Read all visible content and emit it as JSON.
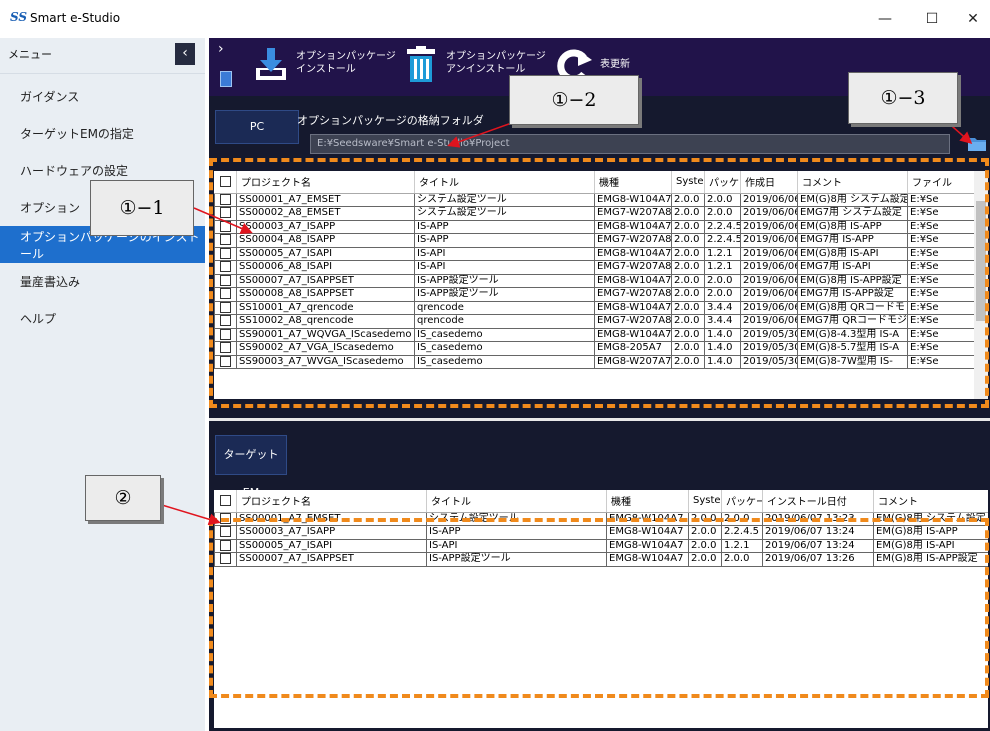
{
  "app": {
    "logo": "SS",
    "title": "Smart e-Studio",
    "min": "—",
    "max": "☐",
    "close": "✕"
  },
  "sidebar": {
    "menu_title": "メニュー",
    "collapse": "‹",
    "items": [
      {
        "label": "ガイダンス",
        "active": false
      },
      {
        "label": "ターゲットEMの指定",
        "active": false
      },
      {
        "label": "ハードウェアの設定",
        "active": false
      },
      {
        "label": "オプション",
        "active": false
      },
      {
        "label": "オプションパッケージのインストール",
        "active": true
      },
      {
        "label": "量産書込み",
        "active": false
      },
      {
        "label": "ヘルプ",
        "active": false
      }
    ]
  },
  "toolbar": {
    "chevron": "›",
    "install_line1": "オプションパッケージ",
    "install_line2": "インストール",
    "uninstall_line1": "オプションパッケージ",
    "uninstall_line2": "アンインストール",
    "refresh": "表更新"
  },
  "pc": {
    "badge": "PC",
    "folder_label": "オプションパッケージの格納フォルダ",
    "folder_path": "E:¥Seedsware¥Smart e-Studio¥Project"
  },
  "pc_table": {
    "headers": [
      "",
      "プロジェクト名",
      "タイトル",
      "機種",
      "System",
      "パッケージ",
      "作成日",
      "コメント",
      "ファイル"
    ],
    "rows": [
      [
        "SS00001_A7_EMSET",
        "システム設定ツール",
        "EMG8-W104A7",
        "2.0.0",
        "2.0.0",
        "2019/06/06",
        "EM(G)8用 システム設定",
        "E:¥Se"
      ],
      [
        "SS00002_A8_EMSET",
        "システム設定ツール",
        "EMG7-W207A8",
        "2.0.0",
        "2.0.0",
        "2019/06/06",
        "EMG7用 システム設定",
        "E:¥Se"
      ],
      [
        "SS00003_A7_ISAPP",
        "IS-APP",
        "EMG8-W104A7",
        "2.0.0",
        "2.2.4.5",
        "2019/06/06",
        "EM(G)8用 IS-APP",
        "E:¥Se"
      ],
      [
        "SS00004_A8_ISAPP",
        "IS-APP",
        "EMG7-W207A8",
        "2.0.0",
        "2.2.4.5",
        "2019/06/06",
        "EMG7用 IS-APP",
        "E:¥Se"
      ],
      [
        "SS00005_A7_ISAPI",
        "IS-API",
        "EMG8-W104A7",
        "2.0.0",
        "1.2.1",
        "2019/06/06",
        "EM(G)8用 IS-API",
        "E:¥Se"
      ],
      [
        "SS00006_A8_ISAPI",
        "IS-API",
        "EMG7-W207A8",
        "2.0.0",
        "1.2.1",
        "2019/06/06",
        "EMG7用 IS-API",
        "E:¥Se"
      ],
      [
        "SS00007_A7_ISAPPSET",
        "IS-APP設定ツール",
        "EMG8-W104A7",
        "2.0.0",
        "2.0.0",
        "2019/06/06",
        "EM(G)8用 IS-APP設定",
        "E:¥Se"
      ],
      [
        "SS00008_A8_ISAPPSET",
        "IS-APP設定ツール",
        "EMG7-W207A8",
        "2.0.0",
        "2.0.0",
        "2019/06/06",
        "EMG7用 IS-APP設定",
        "E:¥Se"
      ],
      [
        "SS10001_A7_qrencode",
        "qrencode",
        "EMG8-W104A7",
        "2.0.0",
        "3.4.4",
        "2019/06/06",
        "EM(G)8用 QRコードモ",
        "E:¥Se"
      ],
      [
        "SS10002_A8_qrencode",
        "qrencode",
        "EMG7-W207A8",
        "2.0.0",
        "3.4.4",
        "2019/06/06",
        "EMG7用 QRコードモジ",
        "E:¥Se"
      ],
      [
        "SS90001_A7_WQVGA_IScasedemo",
        "IS_casedemo",
        "EMG8-W104A7",
        "2.0.0",
        "1.4.0",
        "2019/05/30",
        "EM(G)8-4.3型用 IS-A",
        "E:¥Se"
      ],
      [
        "SS90002_A7_VGA_IScasedemo",
        "IS_casedemo",
        "EMG8-205A7",
        "2.0.0",
        "1.4.0",
        "2019/05/30",
        "EM(G)8-5.7型用 IS-A",
        "E:¥Se"
      ],
      [
        "SS90003_A7_WVGA_IScasedemo",
        "IS_casedemo",
        "EMG8-W207A7",
        "2.0.0",
        "1.4.0",
        "2019/05/30",
        "EM(G)8-7W型用 IS-",
        "E:¥Se"
      ]
    ]
  },
  "target": {
    "badge": "ターゲットEM"
  },
  "target_table": {
    "headers": [
      "",
      "プロジェクト名",
      "タイトル",
      "機種",
      "System",
      "パッケージ",
      "インストール日付",
      "コメント"
    ],
    "rows": [
      [
        "SS00001_A7_EMSET",
        "システム設定ツール",
        "EMG8-W104A7",
        "2.0.0",
        "2.0.0",
        "2019/06/07 13:23",
        "EM(G)8用 システム設定"
      ],
      [
        "SS00003_A7_ISAPP",
        "IS-APP",
        "EMG8-W104A7",
        "2.0.0",
        "2.2.4.5",
        "2019/06/07 13:24",
        "EM(G)8用 IS-APP"
      ],
      [
        "SS00005_A7_ISAPI",
        "IS-API",
        "EMG8-W104A7",
        "2.0.0",
        "1.2.1",
        "2019/06/07 13:24",
        "EM(G)8用 IS-API"
      ],
      [
        "SS00007_A7_ISAPPSET",
        "IS-APP設定ツール",
        "EMG8-W104A7",
        "2.0.0",
        "2.0.0",
        "2019/06/07 13:26",
        "EM(G)8用 IS-APP設定"
      ]
    ]
  },
  "callouts": {
    "c1_1": "①−1",
    "c1_2": "①−2",
    "c1_3": "①−3",
    "c2": "②"
  },
  "colors": {
    "accent": "#1e6fcd",
    "toolbar": "#21134a",
    "dark_bg": "#15192e",
    "dash": "#f08a1c",
    "arrow": "#e0141e"
  }
}
